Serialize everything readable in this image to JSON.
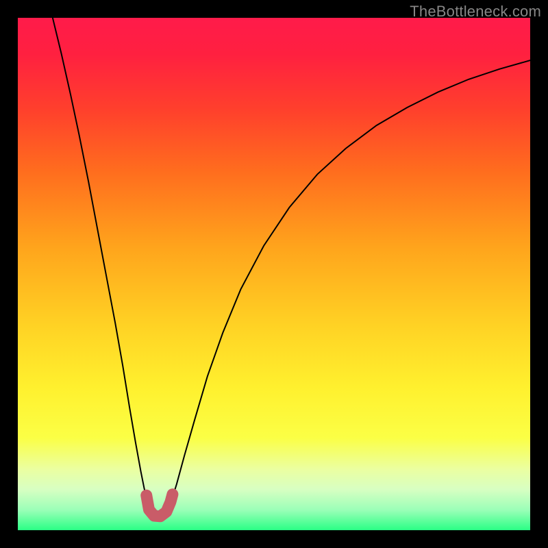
{
  "watermark": "TheBottleneck.com",
  "chart_data": {
    "type": "line",
    "title": "",
    "xlabel": "",
    "ylabel": "",
    "xlim": [
      0,
      1
    ],
    "ylim": [
      0,
      1
    ],
    "background_gradient": {
      "stops": [
        {
          "pos": 0.0,
          "color": "#ff1b4a"
        },
        {
          "pos": 0.07,
          "color": "#ff2040"
        },
        {
          "pos": 0.18,
          "color": "#ff402c"
        },
        {
          "pos": 0.3,
          "color": "#ff6d1e"
        },
        {
          "pos": 0.45,
          "color": "#ffa51c"
        },
        {
          "pos": 0.6,
          "color": "#ffd224"
        },
        {
          "pos": 0.72,
          "color": "#fff02e"
        },
        {
          "pos": 0.82,
          "color": "#fbff45"
        },
        {
          "pos": 0.88,
          "color": "#ebffa0"
        },
        {
          "pos": 0.92,
          "color": "#d8ffc2"
        },
        {
          "pos": 0.96,
          "color": "#9cffb8"
        },
        {
          "pos": 1.0,
          "color": "#2aff85"
        }
      ]
    },
    "series": [
      {
        "name": "left-branch",
        "stroke": "#000000",
        "points": [
          {
            "x": 0.068,
            "y": 1.0
          },
          {
            "x": 0.085,
            "y": 0.93
          },
          {
            "x": 0.103,
            "y": 0.85
          },
          {
            "x": 0.12,
            "y": 0.77
          },
          {
            "x": 0.138,
            "y": 0.68
          },
          {
            "x": 0.155,
            "y": 0.59
          },
          {
            "x": 0.172,
            "y": 0.5
          },
          {
            "x": 0.19,
            "y": 0.405
          },
          {
            "x": 0.205,
            "y": 0.32
          },
          {
            "x": 0.218,
            "y": 0.24
          },
          {
            "x": 0.23,
            "y": 0.17
          },
          {
            "x": 0.24,
            "y": 0.115
          },
          {
            "x": 0.247,
            "y": 0.08
          },
          {
            "x": 0.253,
            "y": 0.058
          }
        ]
      },
      {
        "name": "right-branch",
        "stroke": "#000000",
        "points": [
          {
            "x": 0.3,
            "y": 0.058
          },
          {
            "x": 0.31,
            "y": 0.09
          },
          {
            "x": 0.325,
            "y": 0.145
          },
          {
            "x": 0.345,
            "y": 0.215
          },
          {
            "x": 0.37,
            "y": 0.3
          },
          {
            "x": 0.4,
            "y": 0.385
          },
          {
            "x": 0.435,
            "y": 0.47
          },
          {
            "x": 0.48,
            "y": 0.555
          },
          {
            "x": 0.53,
            "y": 0.63
          },
          {
            "x": 0.585,
            "y": 0.695
          },
          {
            "x": 0.64,
            "y": 0.745
          },
          {
            "x": 0.7,
            "y": 0.79
          },
          {
            "x": 0.76,
            "y": 0.825
          },
          {
            "x": 0.82,
            "y": 0.855
          },
          {
            "x": 0.88,
            "y": 0.88
          },
          {
            "x": 0.94,
            "y": 0.9
          },
          {
            "x": 1.0,
            "y": 0.917
          }
        ]
      },
      {
        "name": "valley-marker",
        "stroke": "#c95c68",
        "stroke_width": 17,
        "points": [
          {
            "x": 0.251,
            "y": 0.068
          },
          {
            "x": 0.256,
            "y": 0.04
          },
          {
            "x": 0.266,
            "y": 0.028
          },
          {
            "x": 0.278,
            "y": 0.027
          },
          {
            "x": 0.29,
            "y": 0.036
          },
          {
            "x": 0.298,
            "y": 0.055
          },
          {
            "x": 0.302,
            "y": 0.07
          }
        ]
      }
    ]
  }
}
